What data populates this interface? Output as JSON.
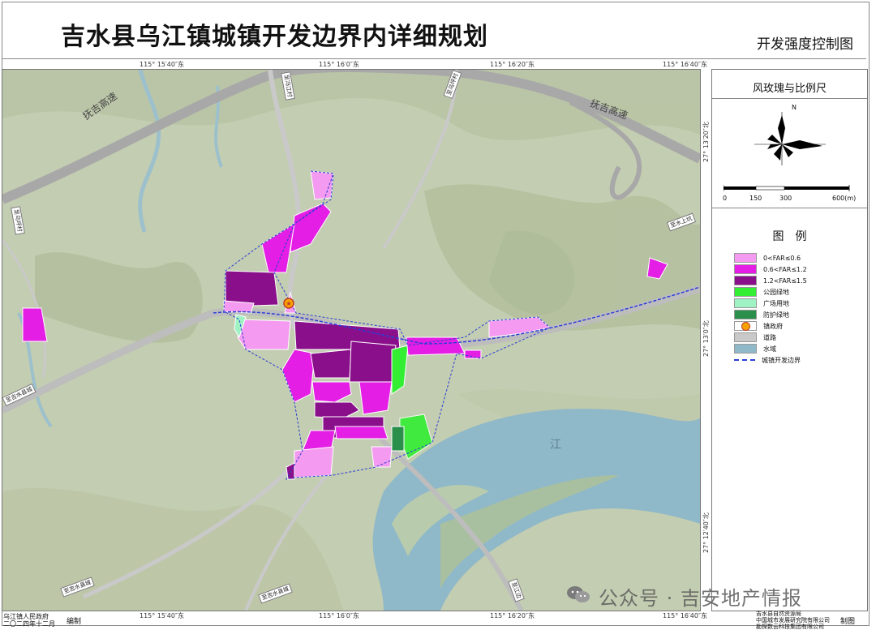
{
  "header": {
    "title": "吉水县乌江镇城镇开发边界内详细规划",
    "subtitle": "开发强度控制图"
  },
  "coords": {
    "top": [
      "115° 15′40″东",
      "115° 16′0″东",
      "115° 16′20″东",
      "115° 16′40″东"
    ],
    "bottom": [
      "115° 15′40″东",
      "115° 16′0″东",
      "115° 16′20″东",
      "115° 16′40″东"
    ],
    "right": [
      "27° 13′20″北",
      "27° 13′0″北",
      "27° 12′40″北"
    ]
  },
  "map_labels": {
    "highway_left": "抚吉高速",
    "highway_right": "抚吉高速",
    "river": "江",
    "roads": [
      "至冯江村",
      "至乌坪村",
      "至乌坪村",
      "至水上坑",
      "至吉水县城",
      "至吉水县城",
      "至吉水县城",
      "至江边"
    ]
  },
  "panel": {
    "compass_title": "风玫瑰与比例尺",
    "north": "N",
    "scale": [
      "0",
      "150",
      "300",
      "600(m)"
    ],
    "legend_title": "图　例",
    "legend": [
      {
        "label": "0<FAR≤0.6",
        "color": "#f49af0"
      },
      {
        "label": "0.6<FAR≤1.2",
        "color": "#e41ee4"
      },
      {
        "label": "1.2<FAR≤1.5",
        "color": "#8a0f8a"
      },
      {
        "label": "公园绿地",
        "color": "#33ee33"
      },
      {
        "label": "广场用地",
        "color": "#9ff2c4"
      },
      {
        "label": "防护绿地",
        "color": "#2a8f4a"
      },
      {
        "label": "镇政府",
        "color": "#f5a300"
      },
      {
        "label": "道路",
        "color": "#c9c9c9"
      },
      {
        "label": "水域",
        "color": "#8fb8c9"
      },
      {
        "label": "城镇开发边界",
        "color": "#2b3fd4"
      }
    ]
  },
  "footer": {
    "left_line1": "乌江镇人民政府",
    "left_line2": "二〇二四年十二月",
    "mid": "编制",
    "right_line1": "吉水县自然资源局",
    "right_line2": "中国城市发展研究院有限公司",
    "right_line3": "勘探数云科技集团有限公司",
    "right_suffix": "制图"
  },
  "watermark": "公众号 · 吉安地产情报"
}
